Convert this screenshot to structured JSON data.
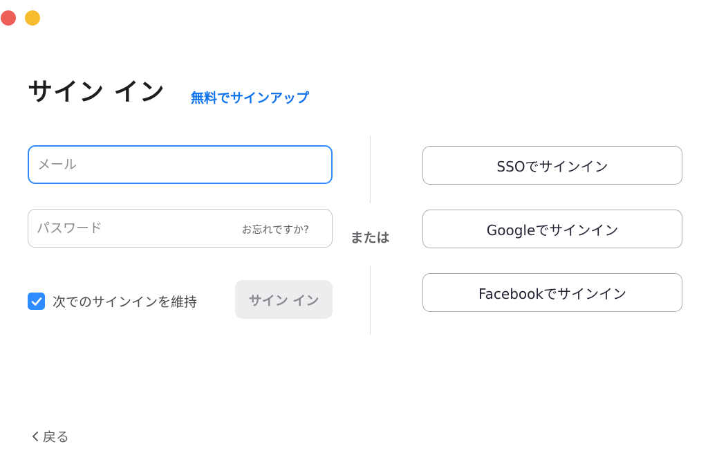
{
  "window": {
    "controls": [
      "close",
      "minimize"
    ]
  },
  "header": {
    "title": "サイン イン",
    "signup_link": "無料でサインアップ"
  },
  "form": {
    "email_placeholder": "メール",
    "email_value": "",
    "password_placeholder": "パスワード",
    "password_value": "",
    "forgot_label": "お忘れですか?",
    "remember_label": "次でのサインインを維持",
    "remember_checked": true,
    "signin_label": "サイン イン"
  },
  "divider": {
    "or_label": "または"
  },
  "alt_signin": [
    {
      "label": "SSOでサインイン"
    },
    {
      "label": "Googleでサインイン"
    },
    {
      "label": "Facebookでサインイン"
    }
  ],
  "footer": {
    "back_label": "戻る",
    "back_icon": "chevron-left-icon"
  },
  "colors": {
    "accent": "#2d8cff",
    "link": "#0e72ed",
    "close": "#ee5f5a",
    "minimize": "#f7bb2f"
  }
}
